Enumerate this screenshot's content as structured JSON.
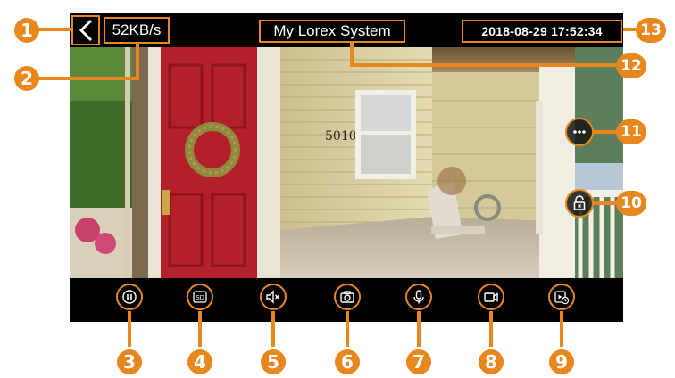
{
  "header": {
    "back_icon": "chevron-left-icon",
    "bitrate": "52KB/s",
    "title": "My Lorex System",
    "datetime": "2018-08-29  17:52:34"
  },
  "video": {
    "house_number": "5010"
  },
  "overlay_buttons": [
    {
      "icon": "more-options-icon"
    },
    {
      "icon": "unlock-icon"
    }
  ],
  "controls": [
    {
      "icon": "pause-icon"
    },
    {
      "icon": "sd-card-icon",
      "text": "SD"
    },
    {
      "icon": "mute-icon"
    },
    {
      "icon": "camera-snapshot-icon"
    },
    {
      "icon": "microphone-icon"
    },
    {
      "icon": "video-record-icon"
    },
    {
      "icon": "playback-icon"
    }
  ],
  "callouts": [
    "1",
    "2",
    "3",
    "4",
    "5",
    "6",
    "7",
    "8",
    "9",
    "10",
    "11",
    "12",
    "13"
  ],
  "colors": {
    "accent": "#e8871e",
    "door": "#b3202a",
    "siding": "#d9cfa0"
  }
}
